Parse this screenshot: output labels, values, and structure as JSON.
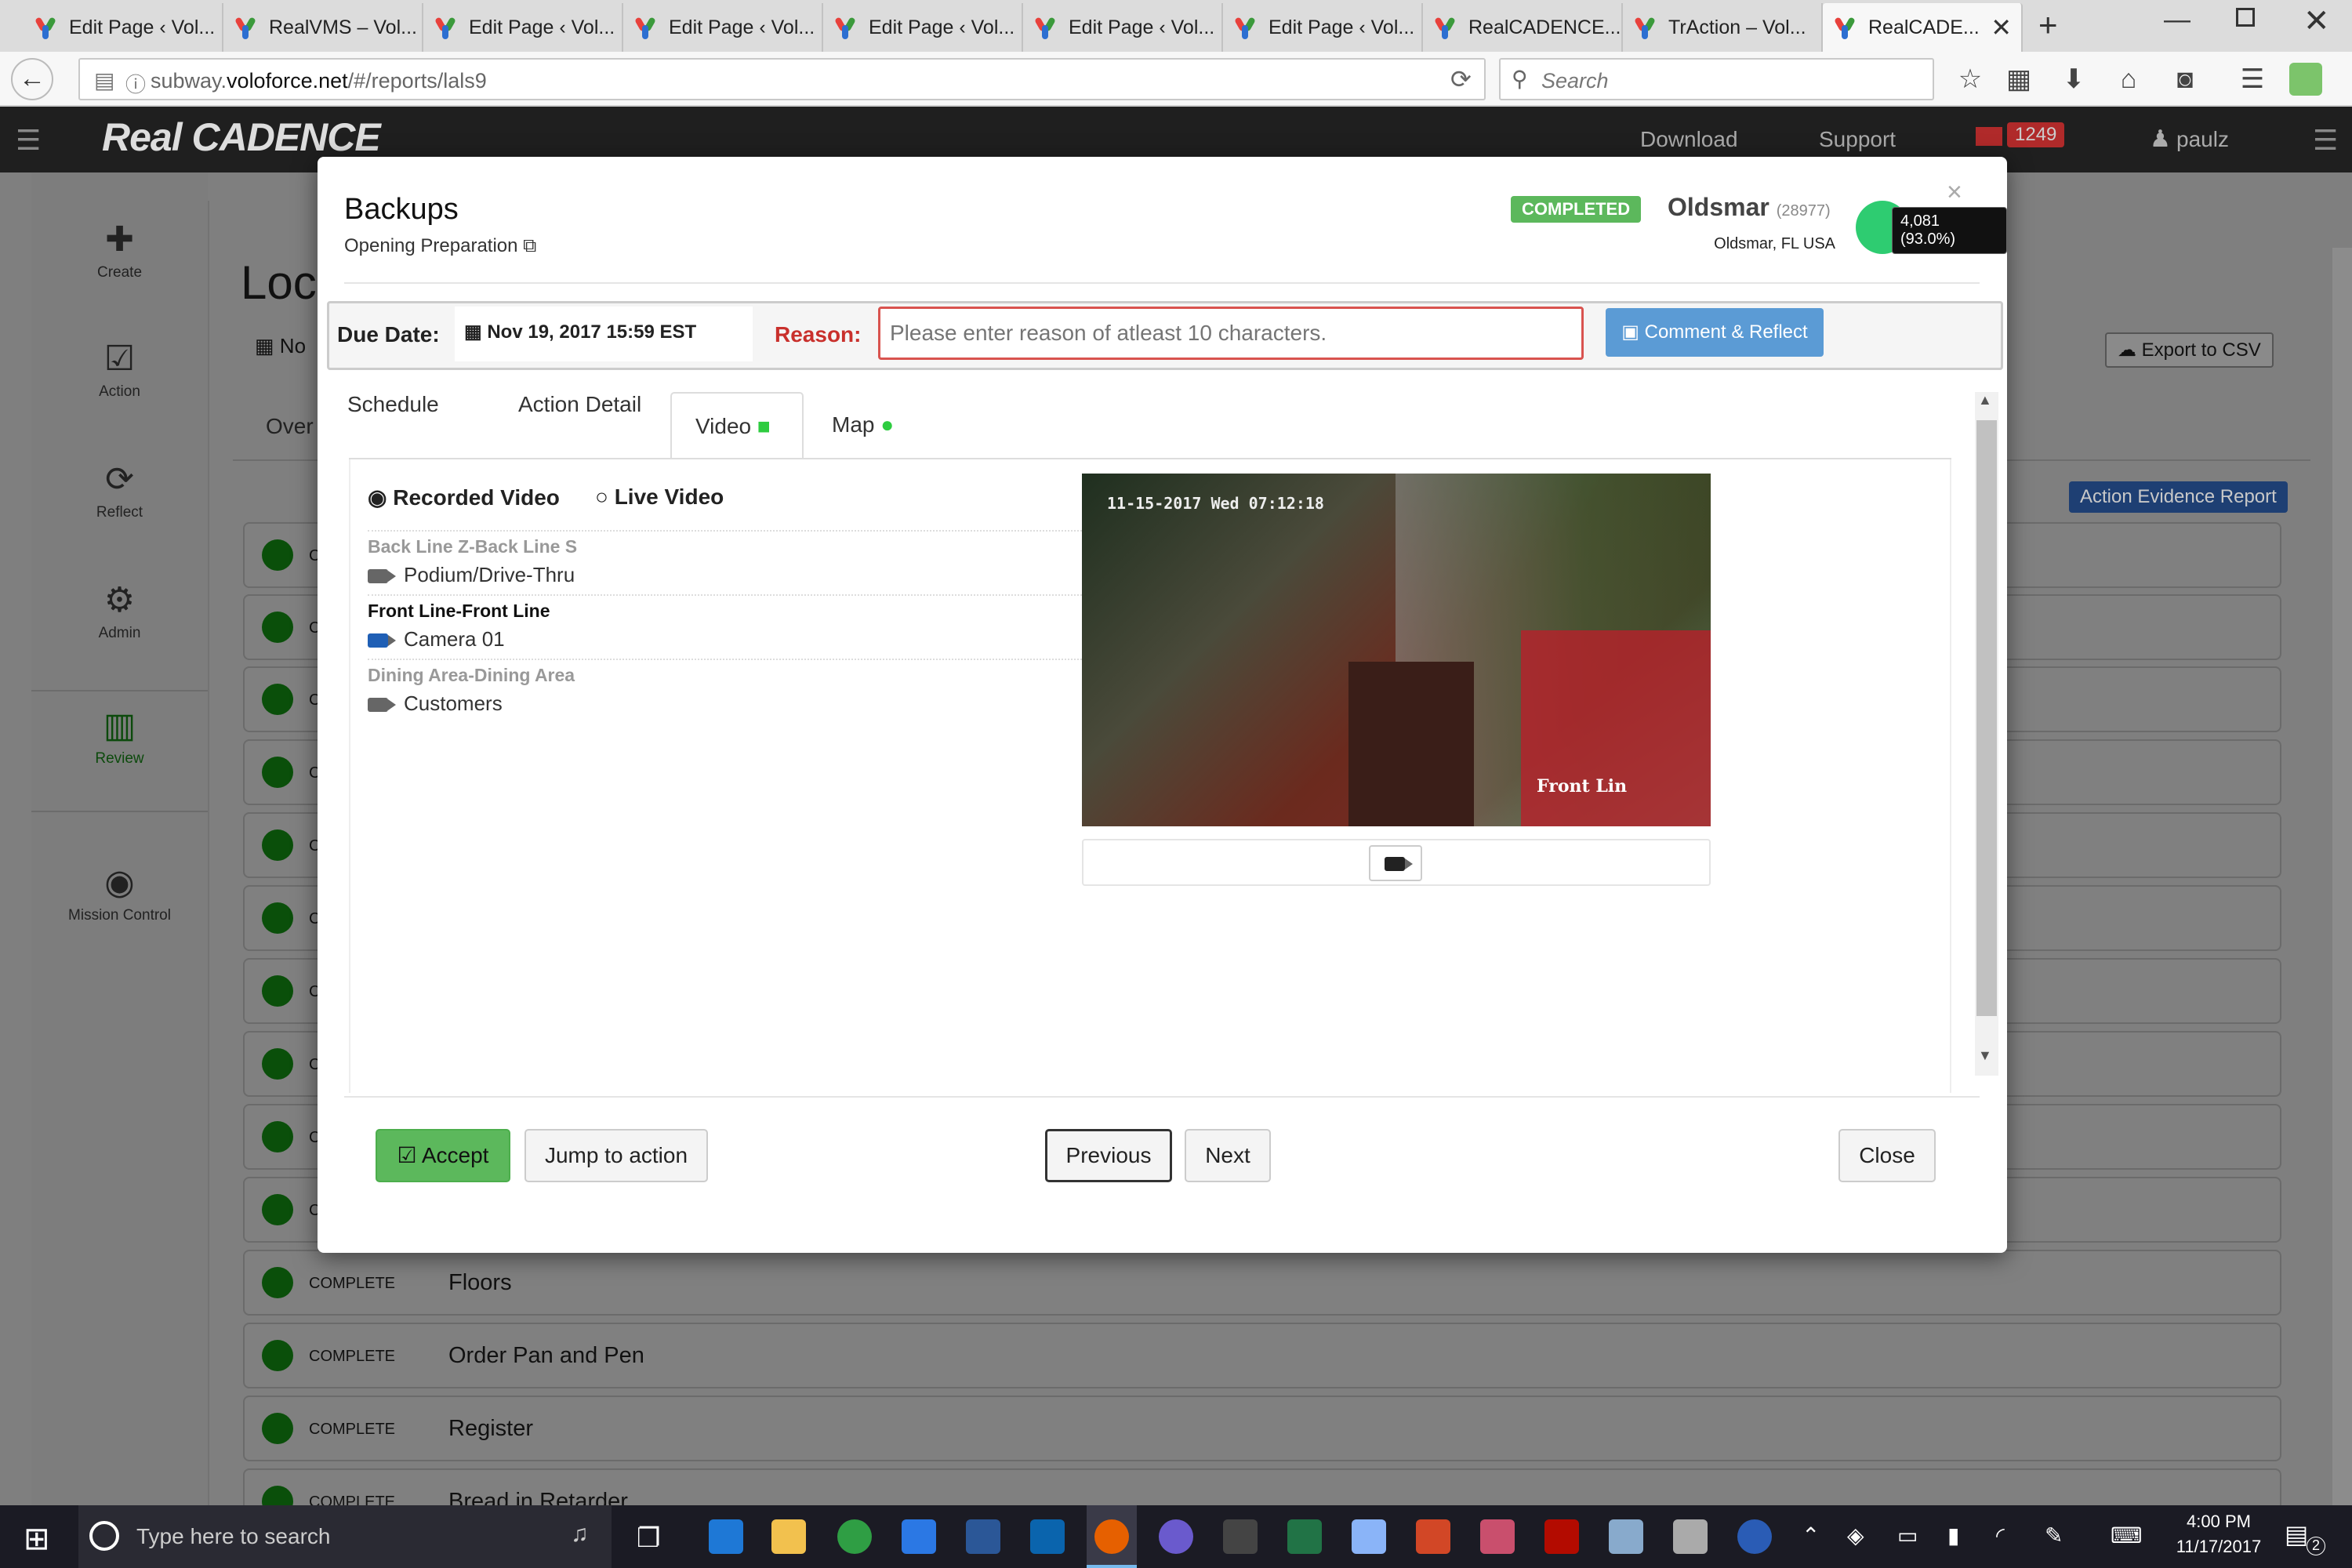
{
  "browser": {
    "tabs": [
      {
        "label": "Edit Page ‹ Vol..."
      },
      {
        "label": "RealVMS – Vol..."
      },
      {
        "label": "Edit Page ‹ Vol..."
      },
      {
        "label": "Edit Page ‹ Vol..."
      },
      {
        "label": "Edit Page ‹ Vol..."
      },
      {
        "label": "Edit Page ‹ Vol..."
      },
      {
        "label": "Edit Page ‹ Vol..."
      },
      {
        "label": "RealCADENCE..."
      },
      {
        "label": "TrAction – Vol..."
      },
      {
        "label": "RealCADE..."
      }
    ],
    "url_host": "subway.",
    "url_domain": "voloforce.net",
    "url_path": "/#/reports/lals9",
    "search_placeholder": "Search"
  },
  "app": {
    "logo": "Real CADENCE",
    "header": {
      "download": "Download",
      "support": "Support",
      "badge": "1249",
      "user": "paulz"
    },
    "sidebar": [
      {
        "label": "Create",
        "icon": "plus-icon"
      },
      {
        "label": "Action",
        "icon": "check-square-icon"
      },
      {
        "label": "Reflect",
        "icon": "refresh-icon"
      },
      {
        "label": "Admin",
        "icon": "gears-icon"
      },
      {
        "label": "Review",
        "icon": "bar-chart-icon"
      },
      {
        "label": "Mission Control",
        "icon": "globe-icon"
      }
    ],
    "page_title": "Loc",
    "date_fragment": "No",
    "overview_fragment": "Over",
    "export_csv": "Export to CSV",
    "evidence_report": "Action Evidence Report",
    "rows": [
      {
        "status": "COMPLETE",
        "name": "Floors"
      },
      {
        "status": "COMPLETE",
        "name": "Order Pan and Pen"
      },
      {
        "status": "COMPLETE",
        "name": "Register"
      },
      {
        "status": "COMPLETE",
        "name": "Bread in Retarder"
      }
    ],
    "hidden_row_fragment": "C"
  },
  "modal": {
    "title": "Backups",
    "subtitle": "Opening Preparation",
    "status_badge": "COMPLETED",
    "store_name": "Oldsmar",
    "store_id": "(28977)",
    "store_location": "Oldsmar, FL USA",
    "score_tooltip": "4,081 (93.0%)",
    "due_label": "Due Date:",
    "due_value": "Nov 19, 2017 15:59 EST",
    "reason_label": "Reason:",
    "reason_placeholder": "Please enter reason of atleast 10 characters.",
    "comment_button": "Comment & Reflect",
    "tabs": [
      "Schedule",
      "Action Detail",
      "Video",
      "Map"
    ],
    "radio_recorded": "Recorded Video",
    "radio_live": "Live Video",
    "camera_groups": [
      {
        "group": "Back Line Z-Back Line S",
        "camera": "Podium/Drive-Thru",
        "active": false
      },
      {
        "group": "Front Line-Front Line",
        "camera": "Camera 01",
        "active": true
      },
      {
        "group": "Dining Area-Dining Area",
        "camera": "Customers",
        "active": false
      }
    ],
    "video_timestamp": "11-15-2017 Wed 07:12:18",
    "video_caption": "Front Lin",
    "buttons": {
      "accept": "Accept",
      "jump": "Jump to action",
      "previous": "Previous",
      "next": "Next",
      "close": "Close"
    },
    "close_x": "×"
  },
  "taskbar": {
    "search_placeholder": "Type here to search",
    "time": "4:00 PM",
    "date": "11/17/2017",
    "notification_count": "2"
  },
  "colors": {
    "accept": "#5cb85c",
    "completed_badge": "#5cb85c",
    "primary": "#5b9bd5",
    "reason_border": "#d9534f",
    "reason_label": "#c9302c",
    "evidence_button": "#1e3f73"
  }
}
